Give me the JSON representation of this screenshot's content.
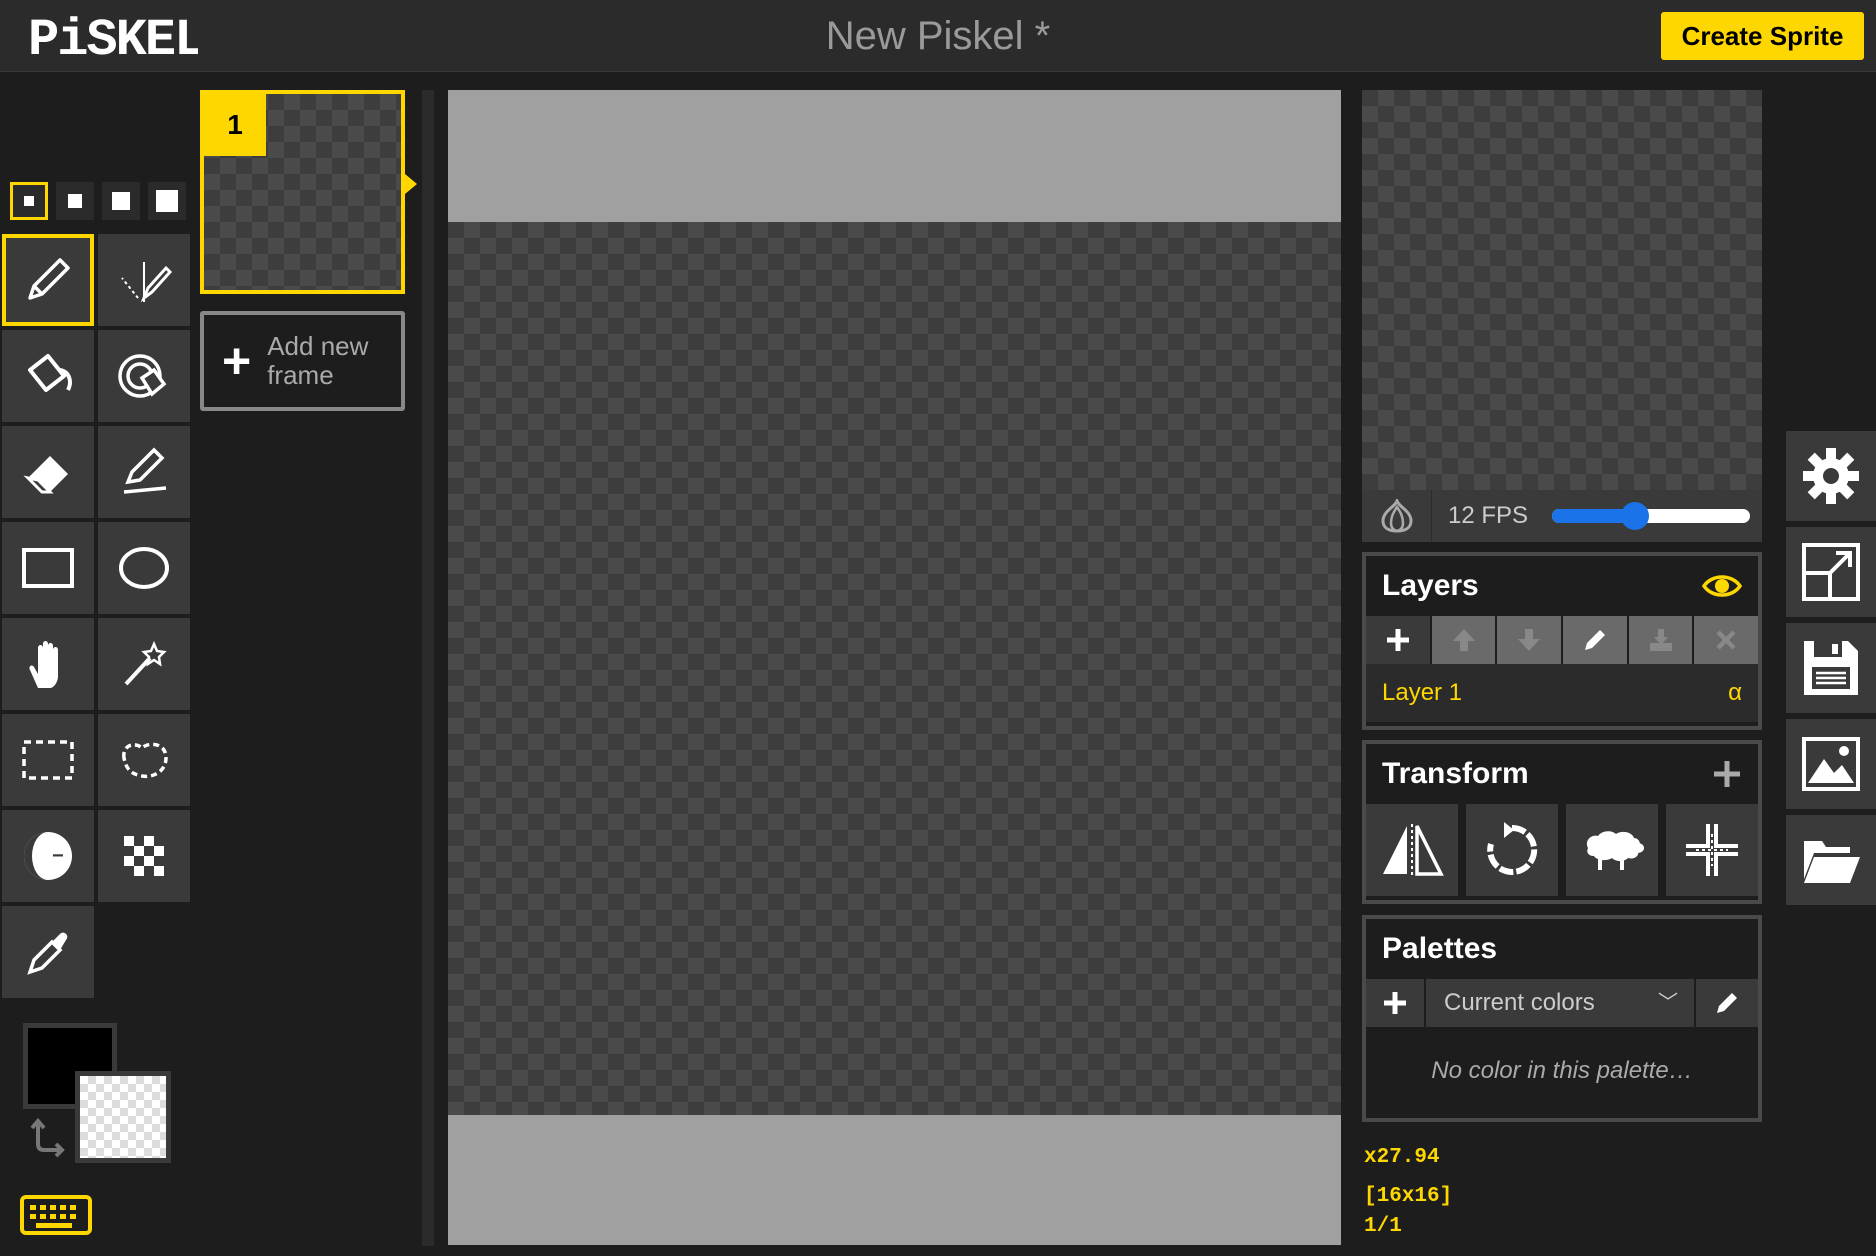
{
  "app": {
    "logo_text": "PiSKEL",
    "title": "New Piskel *",
    "create_button": "Create Sprite"
  },
  "toolbar": {
    "pen_sizes": [
      1,
      2,
      3,
      4
    ],
    "active_pen_size": 1,
    "tools": [
      {
        "name": "pen-tool",
        "icon": "pencil-icon",
        "active": true
      },
      {
        "name": "mirror-pen-tool",
        "icon": "mirror-pencil-icon"
      },
      {
        "name": "paint-bucket-tool",
        "icon": "bucket-icon"
      },
      {
        "name": "paint-all-same-color-tool",
        "icon": "target-bucket-icon"
      },
      {
        "name": "eraser-tool",
        "icon": "eraser-icon"
      },
      {
        "name": "stroke-tool",
        "icon": "line-icon"
      },
      {
        "name": "rectangle-tool",
        "icon": "rectangle-icon"
      },
      {
        "name": "circle-tool",
        "icon": "circle-icon"
      },
      {
        "name": "move-tool",
        "icon": "hand-icon"
      },
      {
        "name": "shape-selection-tool",
        "icon": "magic-wand-icon"
      },
      {
        "name": "rectangle-selection-tool",
        "icon": "dashed-rectangle-icon"
      },
      {
        "name": "lasso-selection-tool",
        "icon": "lasso-icon"
      },
      {
        "name": "lighten-tool",
        "icon": "lighten-darken-icon"
      },
      {
        "name": "dithering-tool",
        "icon": "checker-icon"
      },
      {
        "name": "color-picker-tool",
        "icon": "eyedropper-icon"
      }
    ],
    "primary_color": "#000000",
    "secondary_color": "transparent"
  },
  "frames": {
    "items": [
      {
        "number": "1"
      }
    ],
    "add_label": "Add new frame"
  },
  "preview": {
    "fps_label": "12 FPS",
    "fps_fraction": 0.42
  },
  "layers": {
    "title": "Layers",
    "items": [
      {
        "name": "Layer 1",
        "alpha": "α"
      }
    ]
  },
  "transform": {
    "title": "Transform"
  },
  "palettes": {
    "title": "Palettes",
    "selected": "Current colors",
    "empty_message": "No color in this palette…"
  },
  "info": {
    "zoom": "x27.94",
    "size": "[16x16]",
    "frame": "1/1"
  },
  "colors": {
    "accent": "#ffd700",
    "slider": "#1a73e8"
  }
}
